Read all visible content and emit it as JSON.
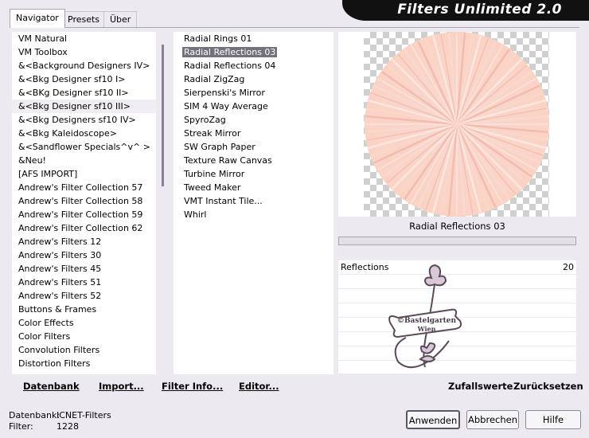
{
  "app": {
    "title": "Filters Unlimited 2.0"
  },
  "tabs": [
    {
      "label": "Navigator",
      "active": true
    },
    {
      "label": "Presets",
      "active": false
    },
    {
      "label": "Über",
      "active": false
    }
  ],
  "categories": {
    "items": [
      "VM Natural",
      "VM Toolbox",
      "&<Background Designers IV>",
      "&<Bkg Designer sf10 I>",
      "&<BKg Designer sf10 II>",
      "&<Bkg Designer sf10 III>",
      "&<Bkg Designers sf10 IV>",
      "&<Bkg Kaleidoscope>",
      "&<Sandflower Specials^v^ >",
      "&Neu!",
      "[AFS IMPORT]",
      "Andrew's Filter Collection 57",
      "Andrew's Filter Collection 58",
      "Andrew's Filter Collection 59",
      "Andrew's Filter Collection 62",
      "Andrew's Filters 12",
      "Andrew's Filters 30",
      "Andrew's Filters 45",
      "Andrew's Filters 51",
      "Andrew's Filters 52",
      "Buttons & Frames",
      "Color Effects",
      "Color Filters",
      "Convolution Filters",
      "Distortion Filters"
    ],
    "selected_index": 5
  },
  "filters": {
    "items": [
      "Radial  Rings 01",
      "Radial Reflections 03",
      "Radial Reflections 04",
      "Radial ZigZag",
      "Sierpenski's Mirror",
      "SIM 4 Way Average",
      "SpyroZag",
      "Streak Mirror",
      "SW Graph Paper",
      "Texture Raw Canvas",
      "Turbine Mirror",
      "Tweed Maker",
      "VMT Instant Tile...",
      "Whirl"
    ],
    "selected_index": 1
  },
  "preview": {
    "name": "Radial Reflections 03",
    "accent": "#f7c9bd"
  },
  "params": [
    {
      "label": "Reflections",
      "value": "20"
    }
  ],
  "watermark": {
    "line1": "©Bastelgarten",
    "line2": "Wien"
  },
  "toolbar": {
    "datenbank": "Datenbank",
    "import": "Import...",
    "filter_info": "Filter Info...",
    "editor": "Editor...",
    "randomize": "Zufallswerte",
    "reset": "Zurücksetzen"
  },
  "status": {
    "db_label": "Datenbank:",
    "db_value": "ICNET-Filters",
    "filter_label": "Filter:",
    "filter_value": "1228"
  },
  "buttons": {
    "apply": "Anwenden",
    "cancel": "Abbrechen",
    "help": "Hilfe"
  }
}
